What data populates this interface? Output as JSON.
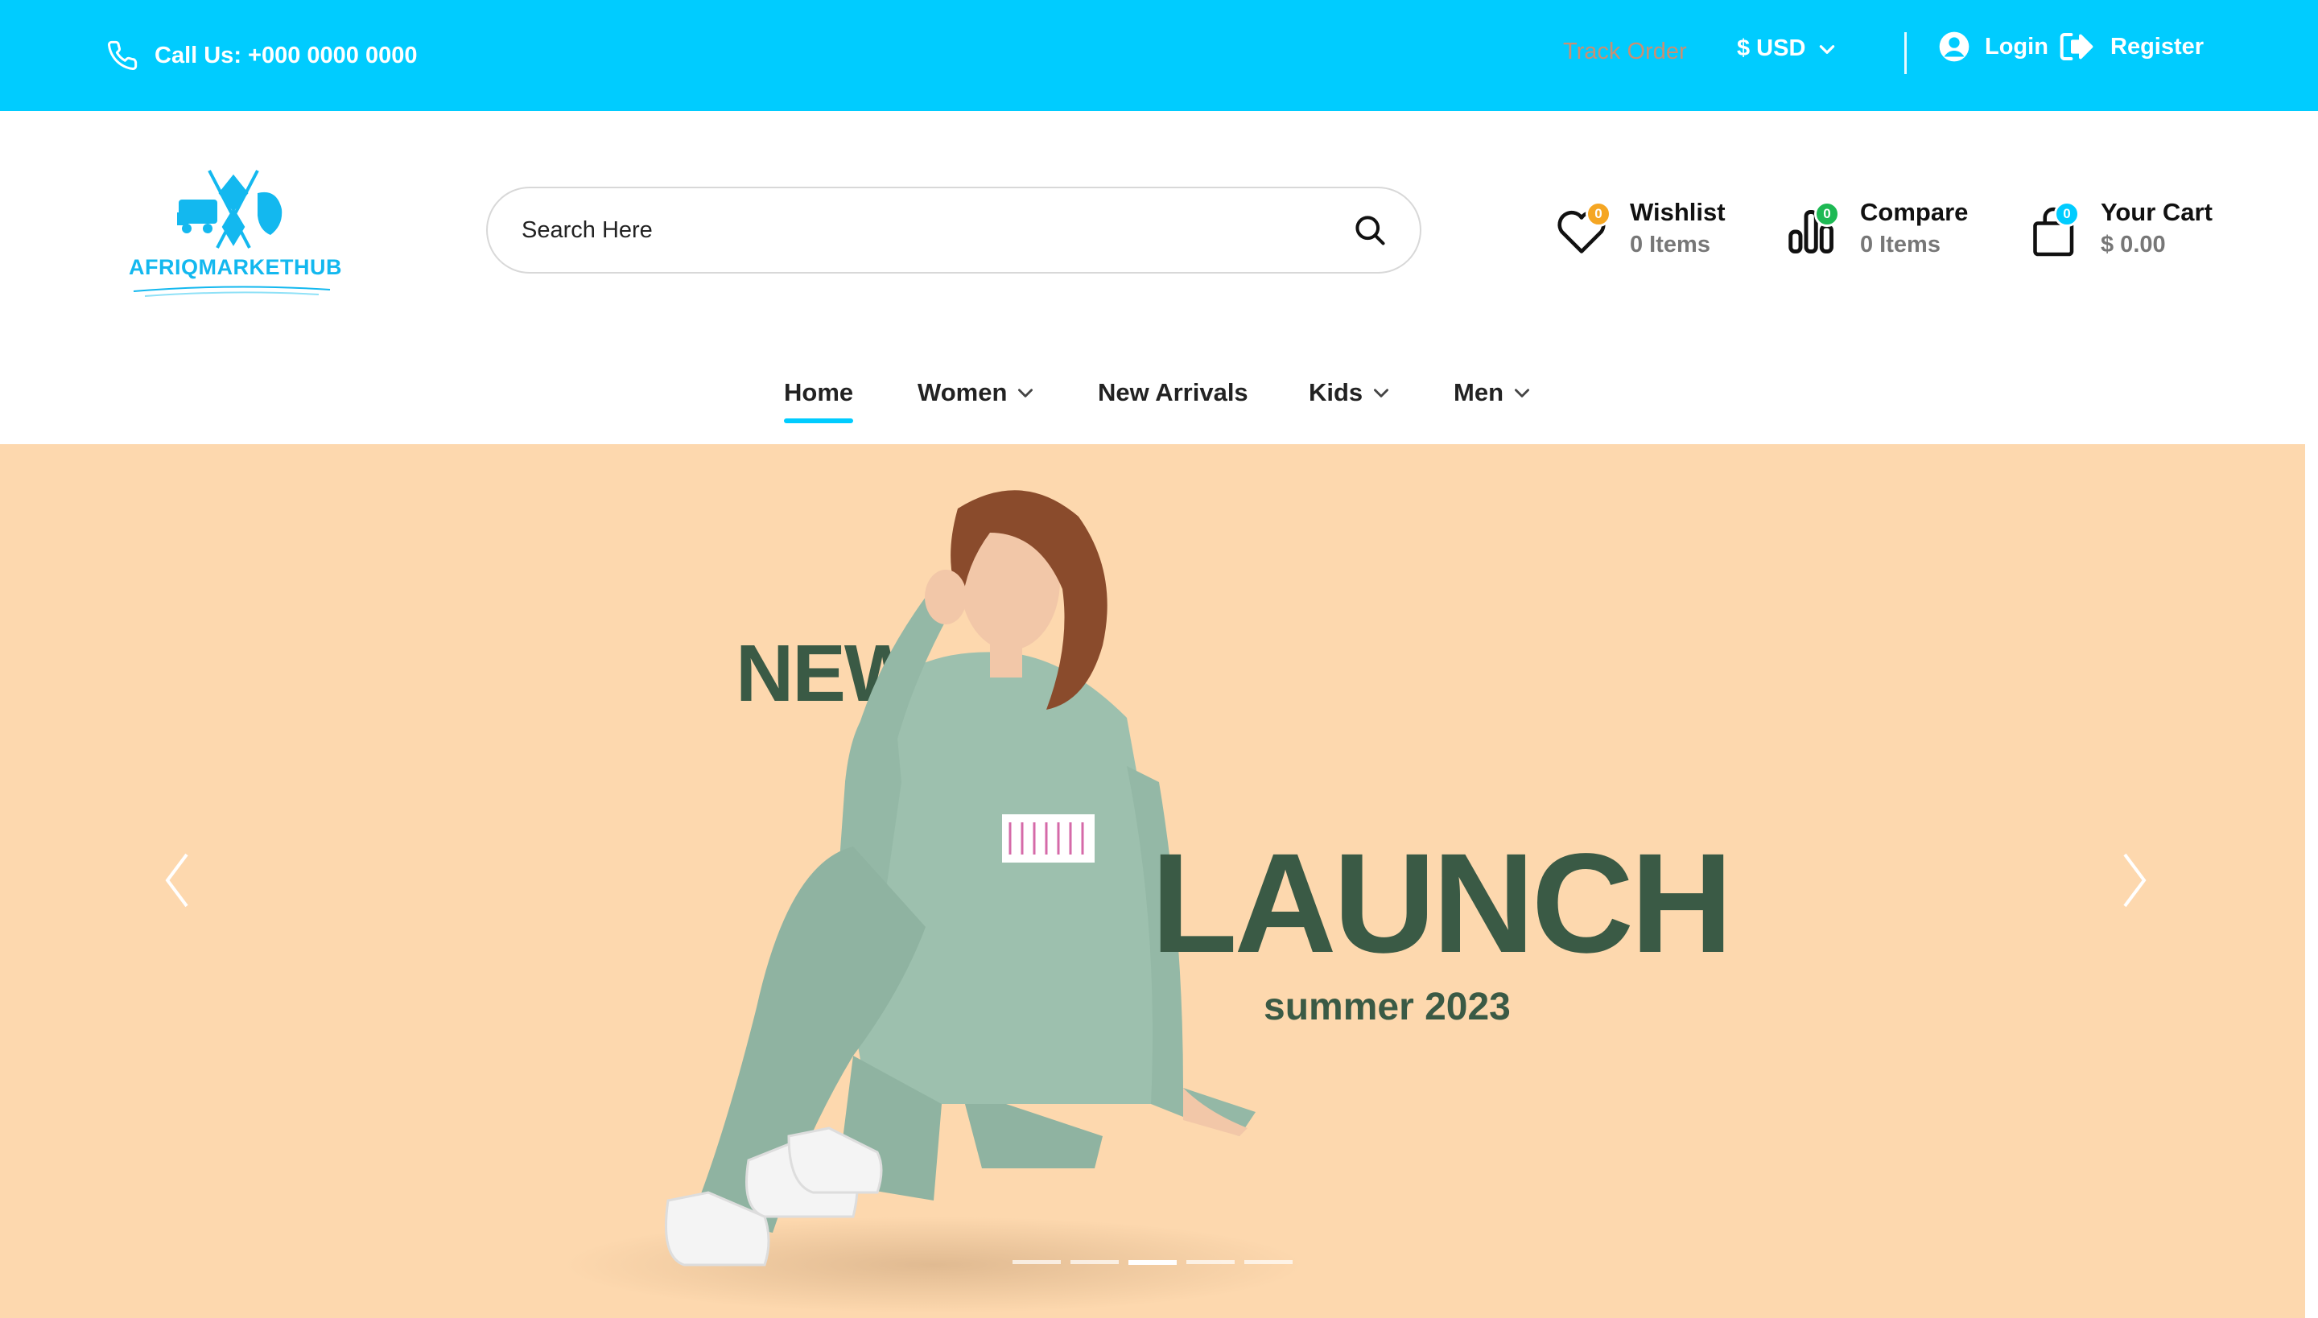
{
  "topbar": {
    "call_text": "Call Us: +000 0000 0000",
    "track_order": "Track Order",
    "currency": "$ USD",
    "login": "Login",
    "register": "Register"
  },
  "logo": {
    "text": "AFRIQMARKETHUB"
  },
  "search": {
    "placeholder": "Search Here"
  },
  "header_items": {
    "wishlist": {
      "title": "Wishlist",
      "sub": "0 Items",
      "badge": "0",
      "badge_color": "#F5A623"
    },
    "compare": {
      "title": "Compare",
      "sub": "0 Items",
      "badge": "0",
      "badge_color": "#1DB954"
    },
    "cart": {
      "title": "Your Cart",
      "sub": "$ 0.00",
      "badge": "0",
      "badge_color": "#00CCFF"
    }
  },
  "nav": {
    "home": "Home",
    "women": "Women",
    "new_arrivals": "New Arrivals",
    "kids": "Kids",
    "men": "Men"
  },
  "hero": {
    "headline_1": "NEW",
    "headline_2": "LAUNCH",
    "subhead": "summer 2023",
    "slides_total": 5,
    "active_slide": 3
  },
  "colors": {
    "brand": "#00CCFF",
    "hero_bg": "#FDD8AE",
    "headline": "#3a5a45"
  }
}
